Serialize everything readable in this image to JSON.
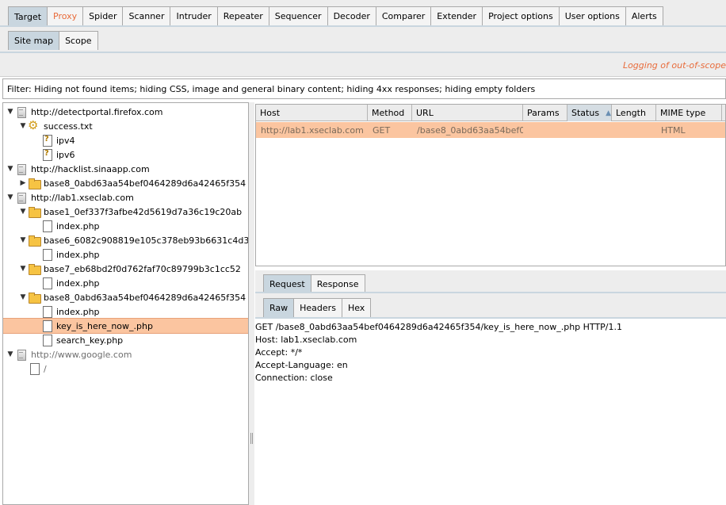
{
  "main_tabs": [
    "Target",
    "Proxy",
    "Spider",
    "Scanner",
    "Intruder",
    "Repeater",
    "Sequencer",
    "Decoder",
    "Comparer",
    "Extender",
    "Project options",
    "User options",
    "Alerts"
  ],
  "sub_tabs": [
    "Site map",
    "Scope"
  ],
  "logging_text": "Logging of out-of-scope",
  "filter_text": "Filter: Hiding not found items;  hiding CSS, image and general binary content;  hiding 4xx responses;  hiding empty folders",
  "tree": [
    {
      "label": "http://detectportal.firefox.com",
      "icon": "host-icon",
      "arrow": "expanded"
    },
    {
      "label": "success.txt",
      "icon": "gear-icon",
      "arrow": "expanded"
    },
    {
      "label": "ipv4",
      "icon": "unknown-file-icon",
      "arrow": ""
    },
    {
      "label": "ipv6",
      "icon": "unknown-file-icon",
      "arrow": ""
    },
    {
      "label": "http://hacklist.sinaapp.com",
      "icon": "host-icon",
      "arrow": "expanded"
    },
    {
      "label": "base8_0abd63aa54bef0464289d6a42465f354",
      "icon": "folder-icon",
      "arrow": "collapsed"
    },
    {
      "label": "http://lab1.xseclab.com",
      "icon": "host-icon",
      "arrow": "expanded"
    },
    {
      "label": "base1_0ef337f3afbe42d5619d7a36c19c20ab",
      "icon": "folder-icon",
      "arrow": "expanded"
    },
    {
      "label": "index.php",
      "icon": "file-icon",
      "arrow": ""
    },
    {
      "label": "base6_6082c908819e105c378eb93b6631c4d3",
      "icon": "folder-icon",
      "arrow": "expanded"
    },
    {
      "label": "index.php",
      "icon": "file-icon",
      "arrow": ""
    },
    {
      "label": "base7_eb68bd2f0d762faf70c89799b3c1cc52",
      "icon": "folder-icon",
      "arrow": "expanded"
    },
    {
      "label": "index.php",
      "icon": "file-icon",
      "arrow": ""
    },
    {
      "label": "base8_0abd63aa54bef0464289d6a42465f354",
      "icon": "folder-icon",
      "arrow": "expanded"
    },
    {
      "label": "index.php",
      "icon": "file-icon",
      "arrow": ""
    },
    {
      "label": "key_is_here_now_.php",
      "icon": "file-icon",
      "arrow": ""
    },
    {
      "label": "search_key.php",
      "icon": "file-icon",
      "arrow": ""
    },
    {
      "label": "http://www.google.com",
      "icon": "host-icon",
      "arrow": "expanded"
    },
    {
      "label": "/",
      "icon": "file-icon",
      "arrow": ""
    }
  ],
  "table": {
    "columns": [
      "Host",
      "Method",
      "URL",
      "Params",
      "Status",
      "Length",
      "MIME type"
    ],
    "rows": [
      {
        "Host": "http://lab1.xseclab.com",
        "Method": "GET",
        "URL": "/base8_0abd63aa54bef0...",
        "Params": "",
        "Status": "",
        "Length": "",
        "MIME type": "HTML"
      }
    ]
  },
  "req_resp_tabs": [
    "Request",
    "Response"
  ],
  "raw_tabs": [
    "Raw",
    "Headers",
    "Hex"
  ],
  "raw_request": [
    "GET /base8_0abd63aa54bef0464289d6a42465f354/key_is_here_now_.php HTTP/1.1",
    "Host: lab1.xseclab.com",
    "Accept: */*",
    "Accept-Language: en",
    "Connection: close"
  ]
}
